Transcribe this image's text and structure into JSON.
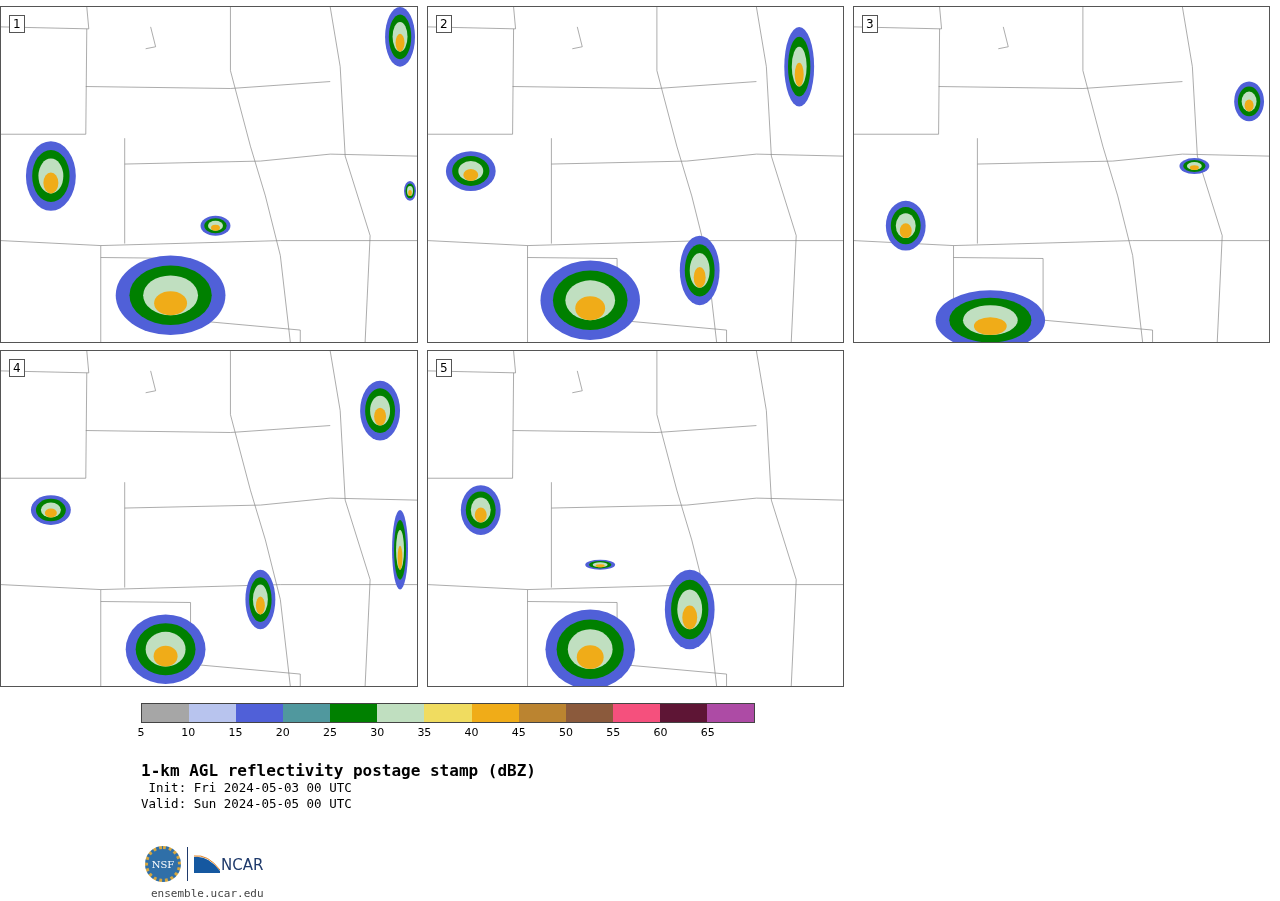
{
  "panels": [
    {
      "label": "1"
    },
    {
      "label": "2"
    },
    {
      "label": "3"
    },
    {
      "label": "4"
    },
    {
      "label": "5"
    }
  ],
  "colorbar": {
    "segments": [
      {
        "color": "#a6a6a6"
      },
      {
        "color": "#b8c4ee"
      },
      {
        "color": "#5060d8"
      },
      {
        "color": "#50989e"
      },
      {
        "color": "#008000"
      },
      {
        "color": "#c0dfc0"
      },
      {
        "color": "#f0dc60"
      },
      {
        "color": "#f0ac18"
      },
      {
        "color": "#bb8430"
      },
      {
        "color": "#8b5a3c"
      },
      {
        "color": "#f5507d"
      },
      {
        "color": "#5e1535"
      },
      {
        "color": "#ad4ba5"
      }
    ],
    "ticks": [
      "5",
      "10",
      "15",
      "20",
      "25",
      "30",
      "35",
      "40",
      "45",
      "50",
      "55",
      "60",
      "65"
    ]
  },
  "title": "1-km AGL reflectivity postage stamp (dBZ)",
  "init": " Init: Fri 2024-05-03 00 UTC",
  "valid": "Valid: Sun 2024-05-05 00 UTC",
  "logos": {
    "nsf": "NSF",
    "ncar": "NCAR"
  },
  "website": "ensemble.ucar.edu"
}
